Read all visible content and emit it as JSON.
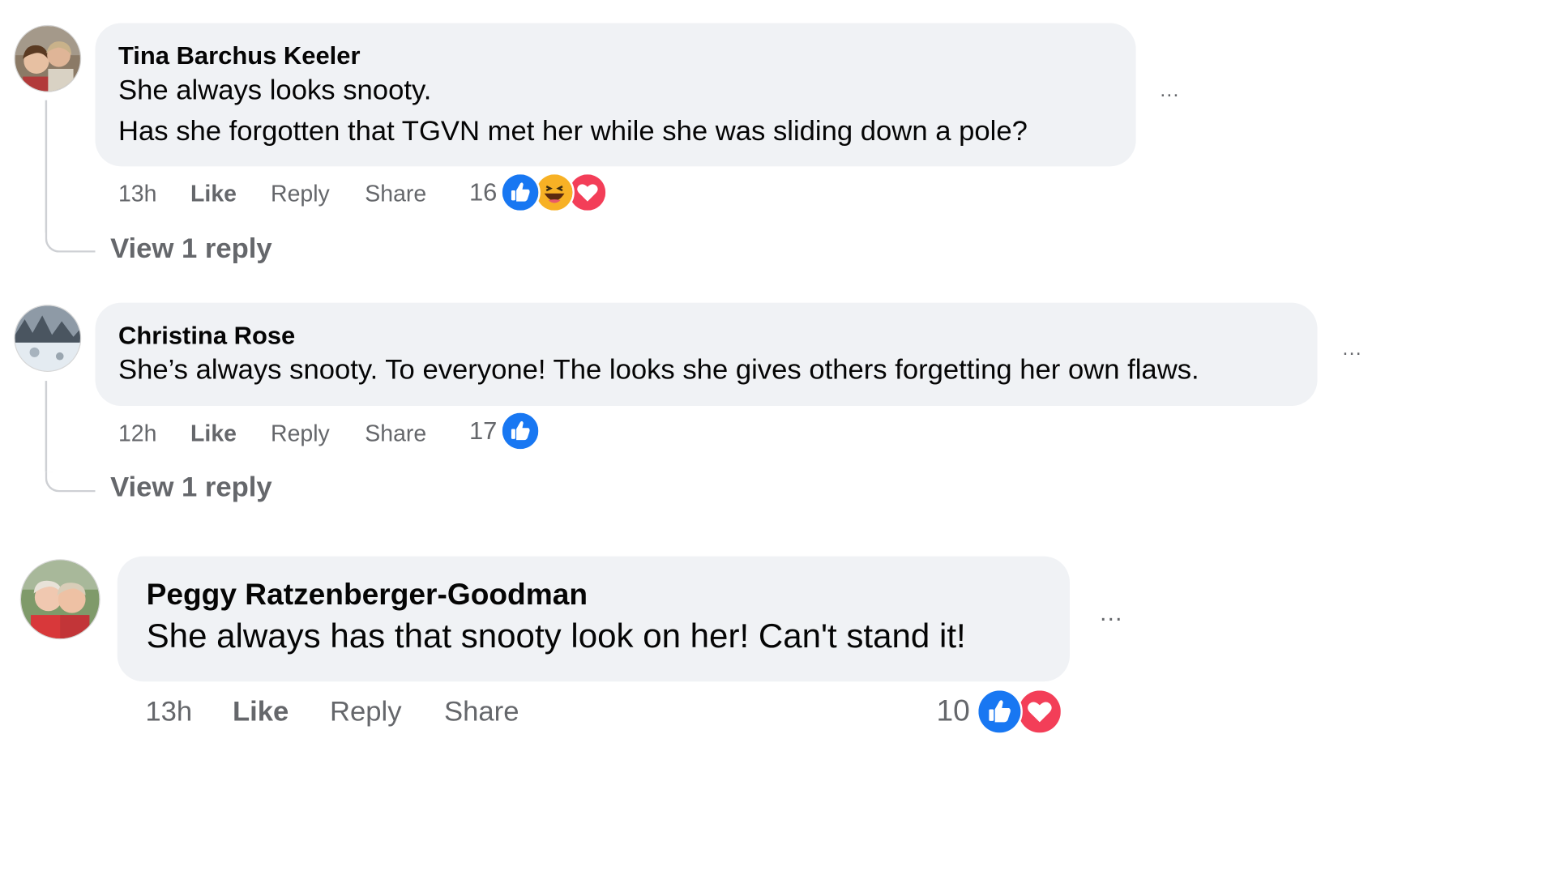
{
  "comments": [
    {
      "author": "Tina Barchus Keeler",
      "text_lines": [
        "She always looks snooty.",
        "Has she forgotten that TGVN met her while she was sliding down a pole?"
      ],
      "time": "13h",
      "like_label": "Like",
      "reply_label": "Reply",
      "share_label": "Share",
      "reaction_count": "16",
      "reactions": [
        "like-icon",
        "haha-icon",
        "love-icon"
      ],
      "view_replies": "View 1 reply",
      "more_label": "..."
    },
    {
      "author": "Christina Rose",
      "text_lines": [
        "She’s always snooty. To everyone! The looks she gives others forgetting her own flaws."
      ],
      "time": "12h",
      "like_label": "Like",
      "reply_label": "Reply",
      "share_label": "Share",
      "reaction_count": "17",
      "reactions": [
        "like-icon"
      ],
      "view_replies": "View 1 reply",
      "more_label": "..."
    },
    {
      "author": "Peggy Ratzenberger-Goodman",
      "text_lines": [
        "She always has that snooty look on her! Can't stand it!"
      ],
      "time": "13h",
      "like_label": "Like",
      "reply_label": "Reply",
      "share_label": "Share",
      "reaction_count": "10",
      "reactions": [
        "like-icon",
        "love-icon"
      ],
      "more_label": "..."
    }
  ],
  "colors": {
    "bubble": "#f0f2f5",
    "secondary_text": "#65676b",
    "like_blue": "#1877f2",
    "love_red": "#f33e58",
    "haha_yellow": "#f7b125"
  }
}
